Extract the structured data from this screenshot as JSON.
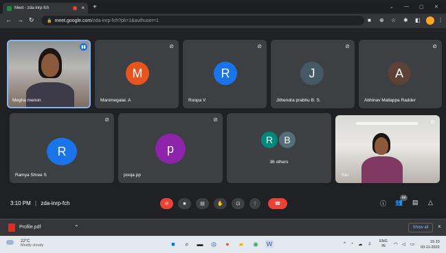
{
  "browser": {
    "tab_title": "Meet - zda-inrp-fch",
    "tab_close": "×",
    "new_tab": "+",
    "url_domain": "meet.google.com",
    "url_path": "/zda-inrp-fch?pli=1&authuser=1"
  },
  "participants": [
    {
      "name": "Megha menon",
      "type": "video"
    },
    {
      "name": "Manimegalai. A",
      "initial": "M",
      "color": "#e8541f"
    },
    {
      "name": "Roopa V",
      "initial": "R",
      "color": "#1a73e8"
    },
    {
      "name": "Jithendra prabhu B. S.",
      "initial": "J",
      "color": "#455a64"
    },
    {
      "name": "Abhinav Mallappa Radder",
      "initial": "A",
      "color": "#5d4037"
    },
    {
      "name": "Ramya Shree S",
      "initial": "R",
      "color": "#1a73e8"
    },
    {
      "name": "pooja pp",
      "initial": "p",
      "color": "#8e24aa"
    },
    {
      "name": "36 others",
      "initials": [
        "R",
        "B"
      ],
      "colors": [
        "#00897b",
        "#546e7a"
      ]
    },
    {
      "name": "You",
      "type": "video"
    }
  ],
  "meetbar": {
    "time": "3:10 PM",
    "separator": "|",
    "meeting_code": "zda-inrp-fch",
    "participant_count": "44"
  },
  "download": {
    "file_name": "Profile.pdf",
    "show_all": "Show all",
    "close": "×"
  },
  "taskbar": {
    "temperature": "22°C",
    "weather": "Mostly cloudy",
    "lang_top": "ENG",
    "lang_bottom": "IN",
    "time": "15:10",
    "date": "03-11-2022"
  }
}
